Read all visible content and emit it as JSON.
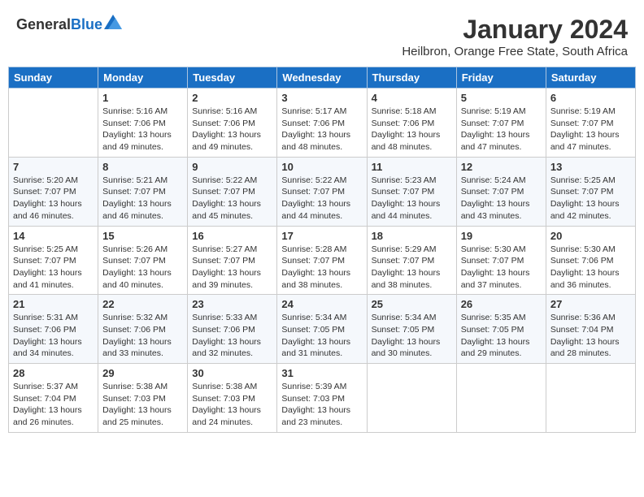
{
  "logo": {
    "general": "General",
    "blue": "Blue"
  },
  "title": "January 2024",
  "subtitle": "Heilbron, Orange Free State, South Africa",
  "days_header": [
    "Sunday",
    "Monday",
    "Tuesday",
    "Wednesday",
    "Thursday",
    "Friday",
    "Saturday"
  ],
  "weeks": [
    [
      {
        "num": "",
        "info": ""
      },
      {
        "num": "1",
        "info": "Sunrise: 5:16 AM\nSunset: 7:06 PM\nDaylight: 13 hours\nand 49 minutes."
      },
      {
        "num": "2",
        "info": "Sunrise: 5:16 AM\nSunset: 7:06 PM\nDaylight: 13 hours\nand 49 minutes."
      },
      {
        "num": "3",
        "info": "Sunrise: 5:17 AM\nSunset: 7:06 PM\nDaylight: 13 hours\nand 48 minutes."
      },
      {
        "num": "4",
        "info": "Sunrise: 5:18 AM\nSunset: 7:06 PM\nDaylight: 13 hours\nand 48 minutes."
      },
      {
        "num": "5",
        "info": "Sunrise: 5:19 AM\nSunset: 7:07 PM\nDaylight: 13 hours\nand 47 minutes."
      },
      {
        "num": "6",
        "info": "Sunrise: 5:19 AM\nSunset: 7:07 PM\nDaylight: 13 hours\nand 47 minutes."
      }
    ],
    [
      {
        "num": "7",
        "info": "Sunrise: 5:20 AM\nSunset: 7:07 PM\nDaylight: 13 hours\nand 46 minutes."
      },
      {
        "num": "8",
        "info": "Sunrise: 5:21 AM\nSunset: 7:07 PM\nDaylight: 13 hours\nand 46 minutes."
      },
      {
        "num": "9",
        "info": "Sunrise: 5:22 AM\nSunset: 7:07 PM\nDaylight: 13 hours\nand 45 minutes."
      },
      {
        "num": "10",
        "info": "Sunrise: 5:22 AM\nSunset: 7:07 PM\nDaylight: 13 hours\nand 44 minutes."
      },
      {
        "num": "11",
        "info": "Sunrise: 5:23 AM\nSunset: 7:07 PM\nDaylight: 13 hours\nand 44 minutes."
      },
      {
        "num": "12",
        "info": "Sunrise: 5:24 AM\nSunset: 7:07 PM\nDaylight: 13 hours\nand 43 minutes."
      },
      {
        "num": "13",
        "info": "Sunrise: 5:25 AM\nSunset: 7:07 PM\nDaylight: 13 hours\nand 42 minutes."
      }
    ],
    [
      {
        "num": "14",
        "info": "Sunrise: 5:25 AM\nSunset: 7:07 PM\nDaylight: 13 hours\nand 41 minutes."
      },
      {
        "num": "15",
        "info": "Sunrise: 5:26 AM\nSunset: 7:07 PM\nDaylight: 13 hours\nand 40 minutes."
      },
      {
        "num": "16",
        "info": "Sunrise: 5:27 AM\nSunset: 7:07 PM\nDaylight: 13 hours\nand 39 minutes."
      },
      {
        "num": "17",
        "info": "Sunrise: 5:28 AM\nSunset: 7:07 PM\nDaylight: 13 hours\nand 38 minutes."
      },
      {
        "num": "18",
        "info": "Sunrise: 5:29 AM\nSunset: 7:07 PM\nDaylight: 13 hours\nand 38 minutes."
      },
      {
        "num": "19",
        "info": "Sunrise: 5:30 AM\nSunset: 7:07 PM\nDaylight: 13 hours\nand 37 minutes."
      },
      {
        "num": "20",
        "info": "Sunrise: 5:30 AM\nSunset: 7:06 PM\nDaylight: 13 hours\nand 36 minutes."
      }
    ],
    [
      {
        "num": "21",
        "info": "Sunrise: 5:31 AM\nSunset: 7:06 PM\nDaylight: 13 hours\nand 34 minutes."
      },
      {
        "num": "22",
        "info": "Sunrise: 5:32 AM\nSunset: 7:06 PM\nDaylight: 13 hours\nand 33 minutes."
      },
      {
        "num": "23",
        "info": "Sunrise: 5:33 AM\nSunset: 7:06 PM\nDaylight: 13 hours\nand 32 minutes."
      },
      {
        "num": "24",
        "info": "Sunrise: 5:34 AM\nSunset: 7:05 PM\nDaylight: 13 hours\nand 31 minutes."
      },
      {
        "num": "25",
        "info": "Sunrise: 5:34 AM\nSunset: 7:05 PM\nDaylight: 13 hours\nand 30 minutes."
      },
      {
        "num": "26",
        "info": "Sunrise: 5:35 AM\nSunset: 7:05 PM\nDaylight: 13 hours\nand 29 minutes."
      },
      {
        "num": "27",
        "info": "Sunrise: 5:36 AM\nSunset: 7:04 PM\nDaylight: 13 hours\nand 28 minutes."
      }
    ],
    [
      {
        "num": "28",
        "info": "Sunrise: 5:37 AM\nSunset: 7:04 PM\nDaylight: 13 hours\nand 26 minutes."
      },
      {
        "num": "29",
        "info": "Sunrise: 5:38 AM\nSunset: 7:03 PM\nDaylight: 13 hours\nand 25 minutes."
      },
      {
        "num": "30",
        "info": "Sunrise: 5:38 AM\nSunset: 7:03 PM\nDaylight: 13 hours\nand 24 minutes."
      },
      {
        "num": "31",
        "info": "Sunrise: 5:39 AM\nSunset: 7:03 PM\nDaylight: 13 hours\nand 23 minutes."
      },
      {
        "num": "",
        "info": ""
      },
      {
        "num": "",
        "info": ""
      },
      {
        "num": "",
        "info": ""
      }
    ]
  ]
}
